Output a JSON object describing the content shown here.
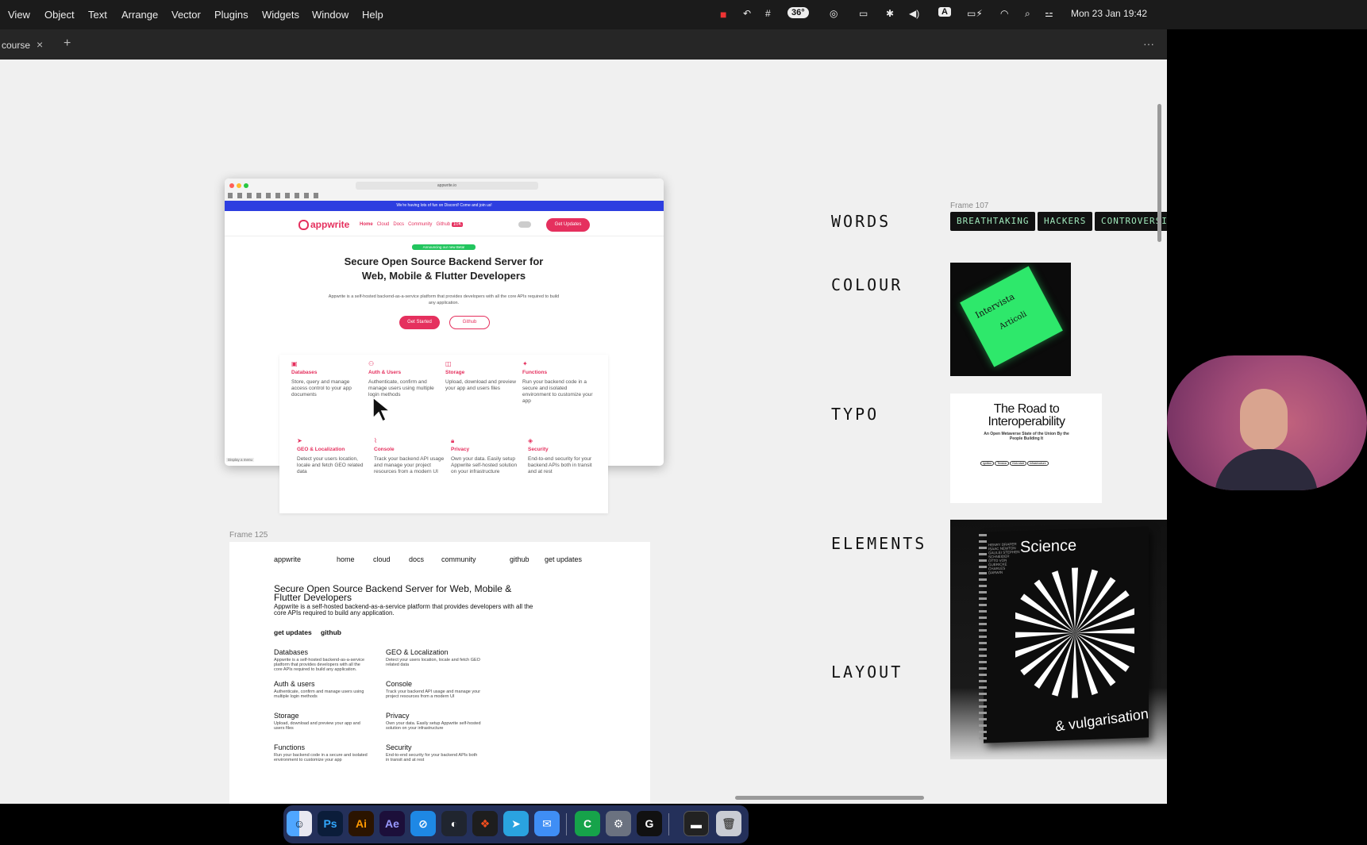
{
  "menubar": {
    "items": [
      "View",
      "Object",
      "Text",
      "Arrange",
      "Vector",
      "Plugins",
      "Widgets",
      "Window",
      "Help"
    ],
    "temperature": "36°",
    "keyboard": "A",
    "datetime": "Mon 23 Jan  19:42"
  },
  "tabs": [
    {
      "label": "course",
      "close": "×"
    }
  ],
  "tab_add": "+",
  "tab_more": "···",
  "browser": {
    "url": "appwrite.io",
    "banner": "We're having lots of fun on   Discord! Come and join us!",
    "logo": "appwrite",
    "nav": [
      "Home",
      "Cloud",
      "Docs",
      "Community",
      "Github"
    ],
    "nav_count": "10K",
    "cta": "Get Updates",
    "badge": "Announcing our new Beta!",
    "title_line1": "Secure Open Source Backend Server for",
    "title_line2": "Web, Mobile & Flutter Developers",
    "desc": "Appwrite is a self-hosted backend-as-a-service platform that provides developers with all the core APIs required to build any application.",
    "btn_primary": "Get Started",
    "btn_secondary": "Github",
    "display": "Display a menu",
    "features": [
      {
        "name": "Databases",
        "desc": "Store, query and manage access control to your app documents"
      },
      {
        "name": "Auth & Users",
        "desc": "Authenticate, confirm and manage users using multiple login methods"
      },
      {
        "name": "Storage",
        "desc": "Upload, download and preview your app and users files"
      },
      {
        "name": "Functions",
        "desc": "Run your backend code in a secure and isolated environment to customize your app"
      },
      {
        "name": "GEO & Localization",
        "desc": "Detect your users location, locale and fetch GEO related data"
      },
      {
        "name": "Console",
        "desc": "Track your backend API usage and manage your project resources from a modern UI"
      },
      {
        "name": "Privacy",
        "desc": "Own your data. Easily setup Appwrite self-hosted solution on your infrastructure"
      },
      {
        "name": "Security",
        "desc": "End-to-end security for your backend APIs both in transit and at rest"
      }
    ]
  },
  "wireframe": {
    "label": "Frame 125",
    "nav": [
      "appwrite",
      "home",
      "cloud",
      "docs",
      "community",
      "github",
      "get updates"
    ],
    "title": "Secure Open Source Backend Server for Web, Mobile & Flutter Developers",
    "desc": "Appwrite is a self-hosted backend-as-a-service platform that provides developers with all the core APIs required to build any application.",
    "links": [
      "get updates",
      "github"
    ],
    "features": [
      {
        "name": "Databases",
        "desc": "Appwrite is a self-hosted backend-as-a-service platform that provides developers with all the core APIs required to build any application."
      },
      {
        "name": "GEO & Localization",
        "desc": "Detect your users location, locale and fetch GEO related data"
      },
      {
        "name": "Auth & users",
        "desc": "Authenticate, confirm and manage users using multiple login methods"
      },
      {
        "name": "Console",
        "desc": "Track your backend API usage and manage your project resources from a modern UI"
      },
      {
        "name": "Storage",
        "desc": "Upload, download and preview your app and users files"
      },
      {
        "name": "Privacy",
        "desc": "Own your data. Easily setup Appwrite self-hosted solution on your infrastructure"
      },
      {
        "name": "Functions",
        "desc": "Run your backend code in a secure and isolated environment to customize your app"
      },
      {
        "name": "Security",
        "desc": "End-to-end security for your backend APIs both in transit and at rest"
      }
    ]
  },
  "moodboard": {
    "labels": [
      "WORDS",
      "COLOUR",
      "TYPO",
      "ELEMENTS",
      "LAYOUT"
    ],
    "frame_label": "Frame 107",
    "words": [
      "BREATHTAKING",
      "HACKERS",
      "CONTROVERSI"
    ],
    "colour_card": {
      "title": "Intervista",
      "sub": "Articoli"
    },
    "typo_card": {
      "title": "The Road to Interoperability",
      "sub": "An Open Metaverse State of the Union By the People Building It",
      "pills": [
        "Ignition",
        "Tension",
        "Kick-start",
        "Infrastructure"
      ]
    },
    "book": {
      "title": "Science",
      "subtitle": "& vulgarisation",
      "names": "HENRY DRAPER ISAAC NEWTON GALILEI STEPHEN SCHNEIDER OTTO VON GUERICKE CHARLES DARWIN"
    }
  },
  "dock": [
    "Finder",
    "Ps",
    "Ai",
    "Ae",
    "Safari",
    "Blender",
    "Figma",
    "Telegram",
    "Mail",
    "Camtasia",
    "System Settings",
    "Logitech",
    "Terminal",
    "Trash"
  ],
  "colors": {
    "accent": "#e5305e",
    "banner": "#2d3ee0",
    "canvas": "#f0f0f0",
    "menubar": "#1b1b1b",
    "tag_text": "#9ee6b9",
    "green_card": "#2ee86b"
  }
}
